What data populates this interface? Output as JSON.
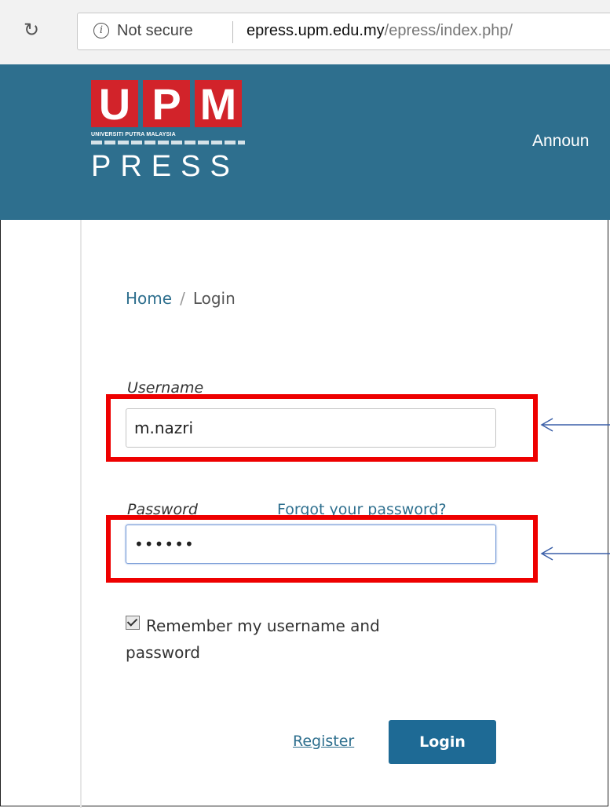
{
  "browser": {
    "security_label": "Not secure",
    "url_host": "epress.upm.edu.my",
    "url_path": "/epress/index.php/"
  },
  "site": {
    "logo_letters": [
      "U",
      "P",
      "M"
    ],
    "logo_subtitle": "UNIVERSITI PUTRA MALAYSIA",
    "logo_word": "PRESS",
    "nav_item": "Announ"
  },
  "breadcrumb": {
    "home": "Home",
    "separator": "/",
    "current": "Login"
  },
  "form": {
    "username_label": "Username",
    "username_value": "m.nazri",
    "password_label": "Password",
    "password_value": "••••••",
    "forgot_link": "Forgot your password?",
    "remember_label": "Remember my username and password",
    "remember_checked": true,
    "register_link": "Register",
    "login_button": "Login"
  },
  "annotations": {
    "highlight_color": "#ee0000",
    "arrow_color": "#3a5fa8"
  },
  "colors": {
    "header_bg": "#2e6f8e",
    "logo_red": "#d2232a",
    "button_bg": "#1e6a95",
    "link": "#2e6f8e"
  }
}
